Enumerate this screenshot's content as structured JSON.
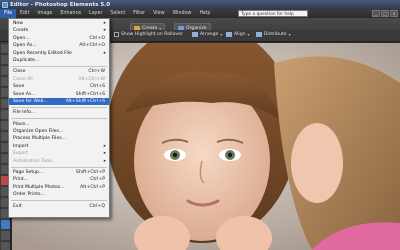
{
  "window": {
    "title": "Editor - Photoshop Elements 5.0"
  },
  "menubar": {
    "items": [
      "File",
      "Edit",
      "Image",
      "Enhance",
      "Layer",
      "Select",
      "Filter",
      "View",
      "Window",
      "Help"
    ],
    "help_placeholder": "Type a question for help",
    "controls": [
      "_",
      "□",
      "x"
    ]
  },
  "toolbar": {
    "create_label": "Create",
    "organize_label": "Organize",
    "show_highlight_label": "Show Highlight on Rollover",
    "arrange_label": "Arrange",
    "align_label": "Align",
    "distribute_label": "Distribute"
  },
  "file_menu": [
    {
      "label": "New",
      "shortcut": "",
      "arrow": true,
      "disabled": false
    },
    {
      "label": "Create",
      "shortcut": "",
      "arrow": true,
      "disabled": false
    },
    {
      "label": "Open...",
      "shortcut": "Ctrl+O",
      "disabled": false
    },
    {
      "label": "Open As...",
      "shortcut": "Alt+Ctrl+O",
      "disabled": false
    },
    {
      "label": "Open Recently Edited File",
      "shortcut": "",
      "arrow": true,
      "disabled": false
    },
    {
      "label": "Duplicate...",
      "shortcut": "",
      "disabled": false
    },
    {
      "sep": true
    },
    {
      "label": "Close",
      "shortcut": "Ctrl+W",
      "disabled": false
    },
    {
      "label": "Close All",
      "shortcut": "Alt+Ctrl+W",
      "disabled": true
    },
    {
      "label": "Save",
      "shortcut": "Ctrl+S",
      "disabled": false
    },
    {
      "label": "Save As...",
      "shortcut": "Shift+Ctrl+S",
      "disabled": false
    },
    {
      "label": "Save for Web...",
      "shortcut": "Alt+Shift+Ctrl+S",
      "disabled": false,
      "highlight": true
    },
    {
      "sep": true
    },
    {
      "label": "File Info...",
      "shortcut": "",
      "disabled": false
    },
    {
      "sep": true
    },
    {
      "label": "Place...",
      "shortcut": "",
      "disabled": false
    },
    {
      "label": "Organize Open Files...",
      "shortcut": "",
      "disabled": false
    },
    {
      "label": "Process Multiple Files...",
      "shortcut": "",
      "disabled": false
    },
    {
      "label": "Import",
      "shortcut": "",
      "arrow": true,
      "disabled": false
    },
    {
      "label": "Export",
      "shortcut": "",
      "arrow": true,
      "disabled": true
    },
    {
      "label": "Automation Tools",
      "shortcut": "",
      "arrow": true,
      "disabled": true
    },
    {
      "sep": true
    },
    {
      "label": "Page Setup...",
      "shortcut": "Shift+Ctrl+P",
      "disabled": false
    },
    {
      "label": "Print...",
      "shortcut": "Ctrl+P",
      "disabled": false
    },
    {
      "label": "Print Multiple Photos...",
      "shortcut": "Alt+Ctrl+P",
      "disabled": false
    },
    {
      "label": "Order Prints...",
      "shortcut": "",
      "disabled": false
    },
    {
      "sep": true
    },
    {
      "label": "Exit",
      "shortcut": "Ctrl+Q",
      "disabled": false
    }
  ],
  "colors": {
    "menu_highlight": "#316ac5",
    "title_bar": "#3a4866"
  }
}
